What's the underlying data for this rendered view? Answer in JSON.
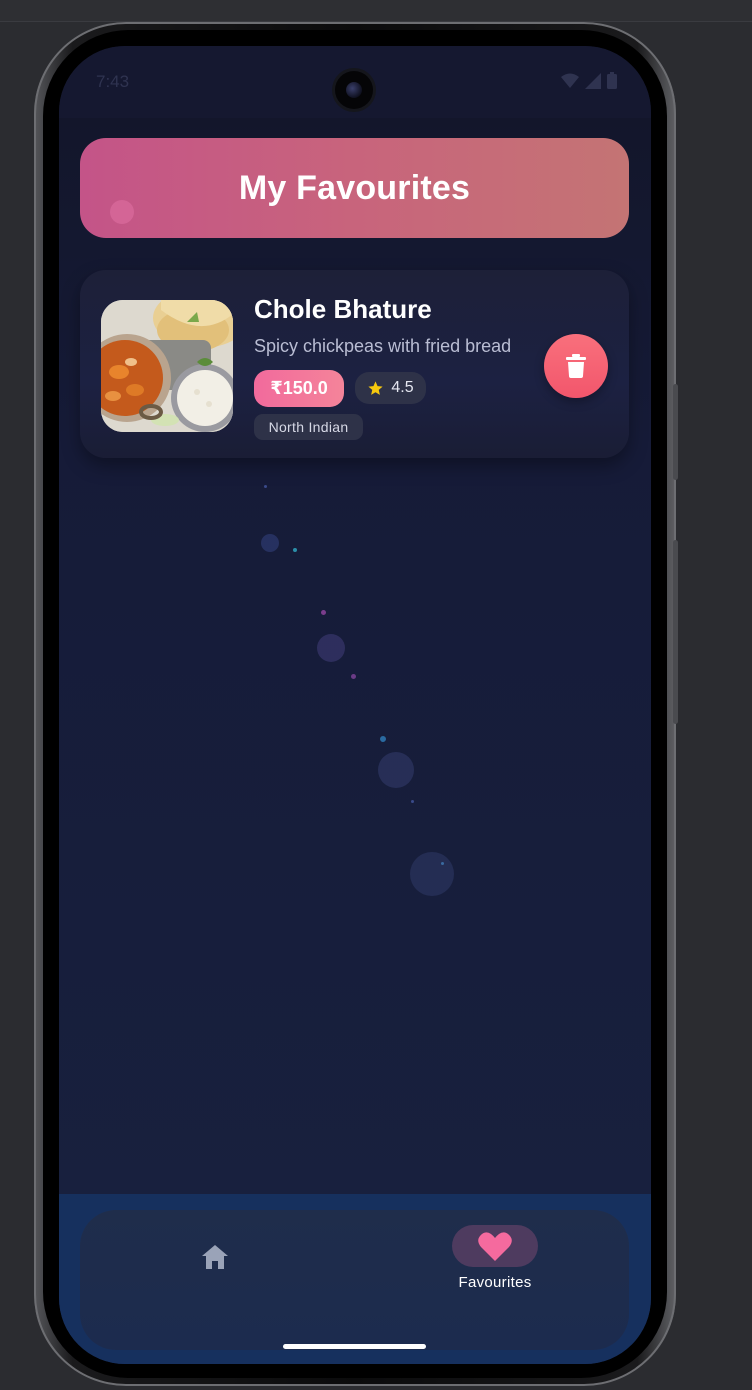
{
  "status_bar": {
    "time": "7:43",
    "icons": [
      "wifi-icon",
      "signal-icon",
      "battery-icon"
    ]
  },
  "header": {
    "title": "My Favourites"
  },
  "favourites": [
    {
      "name": "Chole Bhature",
      "description": "Spicy chickpeas with fried bread",
      "price": "₹150.0",
      "rating": "4.5",
      "cuisine": "North Indian",
      "image": "food-photo",
      "delete_icon": "trash-icon"
    }
  ],
  "bottom_nav": {
    "items": [
      {
        "icon": "home-icon",
        "label": ""
      },
      {
        "icon": "heart-icon",
        "label": "Favourites",
        "active": true
      }
    ]
  },
  "colors": {
    "header_gradient_start": "#c45488",
    "header_gradient_end": "#c47474",
    "price_pill": "#f26a9c",
    "delete_button": "#f2566c",
    "heart_accent": "#f56a9e",
    "background": "#18213f",
    "rating_star": "#f6c90e"
  }
}
